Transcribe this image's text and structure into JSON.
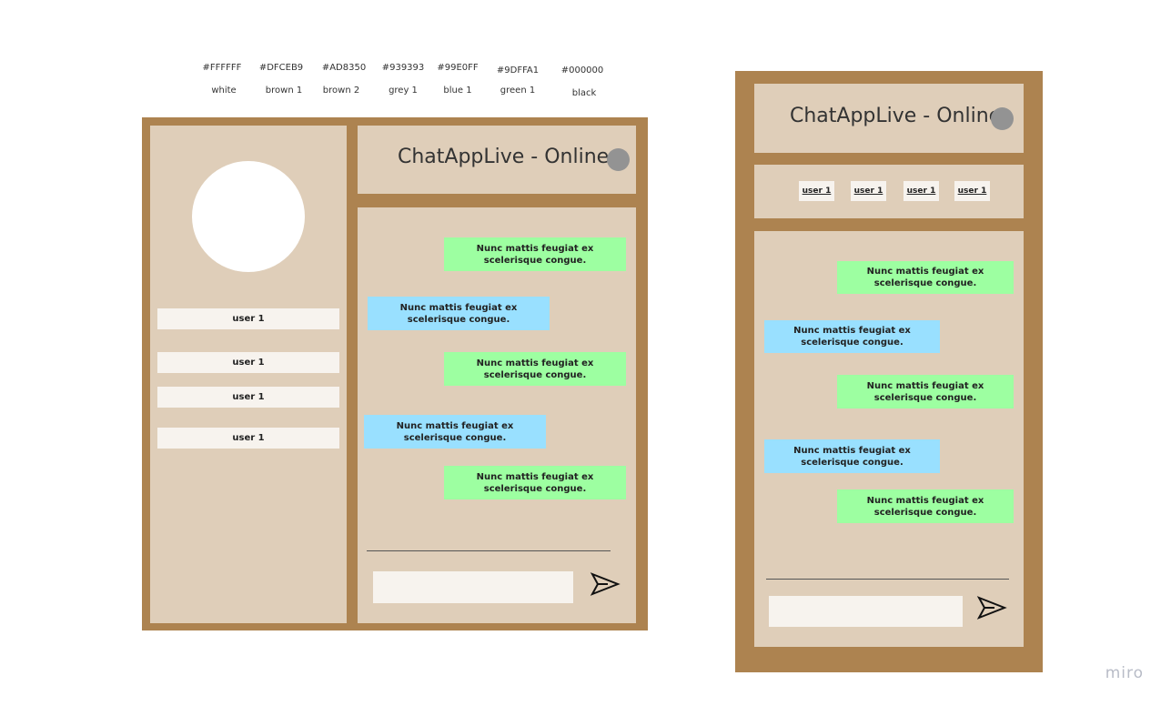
{
  "palette": [
    {
      "hex": "#FFFFFF",
      "name": "white"
    },
    {
      "hex": "#DFCEB9",
      "name": "brown 1"
    },
    {
      "hex": "#AD8350",
      "name": "brown 2"
    },
    {
      "hex": "#939393",
      "name": "grey 1"
    },
    {
      "hex": "#99E0FF",
      "name": "blue 1"
    },
    {
      "hex": "#9DFFA1",
      "name": "green 1"
    },
    {
      "hex": "#000000",
      "name": "black"
    }
  ],
  "desktop": {
    "title": "ChatAppLive - Online",
    "users": [
      "user 1",
      "user 1",
      "user 1",
      "user 1"
    ],
    "messages": [
      {
        "text": "Nunc mattis feugiat ex scelerisque congue.",
        "side": "right",
        "color": "#9DFFA1"
      },
      {
        "text": "Nunc mattis feugiat ex scelerisque congue.",
        "side": "left",
        "color": "#99E0FF"
      },
      {
        "text": "Nunc mattis feugiat ex scelerisque congue.",
        "side": "right",
        "color": "#9DFFA1"
      },
      {
        "text": "Nunc mattis feugiat ex scelerisque congue.",
        "side": "left",
        "color": "#99E0FF"
      },
      {
        "text": "Nunc mattis feugiat ex scelerisque congue.",
        "side": "right",
        "color": "#9DFFA1"
      }
    ],
    "message_input": {
      "value": "",
      "placeholder": ""
    }
  },
  "mobile": {
    "title": "ChatAppLive - Online",
    "users": [
      "user 1",
      "user 1",
      "user 1",
      "user 1"
    ],
    "messages": [
      {
        "text": "Nunc mattis feugiat ex scelerisque congue.",
        "side": "right",
        "color": "#9DFFA1"
      },
      {
        "text": "Nunc mattis feugiat ex scelerisque congue.",
        "side": "left",
        "color": "#99E0FF"
      },
      {
        "text": "Nunc mattis feugiat ex scelerisque congue.",
        "side": "right",
        "color": "#9DFFA1"
      },
      {
        "text": "Nunc mattis feugiat ex scelerisque congue.",
        "side": "left",
        "color": "#99E0FF"
      },
      {
        "text": "Nunc mattis feugiat ex scelerisque congue.",
        "side": "right",
        "color": "#9DFFA1"
      }
    ],
    "message_input": {
      "value": "",
      "placeholder": ""
    }
  },
  "icons": {
    "send": "send-icon",
    "status": "status-dot-icon",
    "avatar": "avatar-circle"
  },
  "watermark": "miro"
}
